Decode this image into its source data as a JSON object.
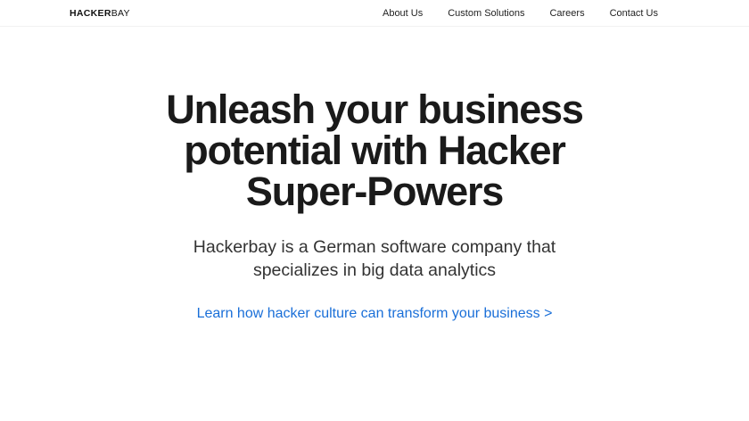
{
  "header": {
    "logo_bold": "HACKER",
    "logo_light": "BAY",
    "nav": [
      {
        "label": "About Us"
      },
      {
        "label": "Custom Solutions"
      },
      {
        "label": "Careers"
      },
      {
        "label": "Contact Us"
      }
    ]
  },
  "hero": {
    "headline_lines": [
      "Unleash your business",
      "potential with Hacker",
      "Super-Powers"
    ],
    "subhead_lines": [
      "Hackerbay is a German software company that",
      "specializes in big data analytics"
    ],
    "cta_label": "Learn how hacker culture can transform your business >"
  },
  "colors": {
    "link": "#1a6fd8",
    "text": "#1a1a1a"
  }
}
